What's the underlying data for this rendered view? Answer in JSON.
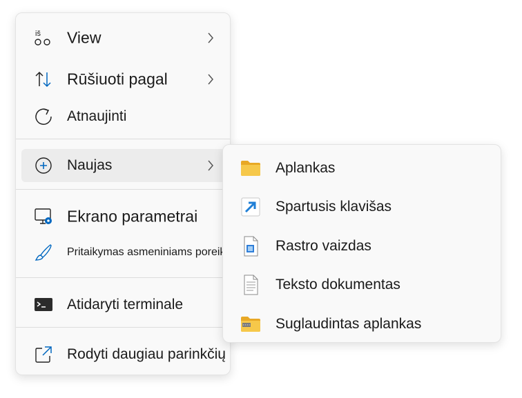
{
  "context_menu": {
    "items": [
      {
        "label": "View",
        "icon": "view-icon",
        "badge": "iš",
        "has_submenu": true
      },
      {
        "label": "Rūšiuoti pagal",
        "icon": "sort-icon",
        "has_submenu": true
      },
      {
        "label": "Atnaujinti",
        "icon": "refresh-icon",
        "has_submenu": false
      },
      {
        "label": "Naujas",
        "icon": "add-circle-icon",
        "has_submenu": true,
        "highlighted": true
      },
      {
        "label": "Ekrano parametrai",
        "icon": "display-settings-icon",
        "has_submenu": false
      },
      {
        "label": "Pritaikymas asmeniniams poreikiams",
        "icon": "paintbrush-icon",
        "has_submenu": false
      },
      {
        "label": "Atidaryti terminale",
        "icon": "terminal-icon",
        "has_submenu": false
      },
      {
        "label": "Rodyti daugiau parinkčių",
        "icon": "share-icon",
        "has_submenu": false
      }
    ]
  },
  "submenu": {
    "items": [
      {
        "label": "Aplankas",
        "icon": "folder-icon"
      },
      {
        "label": "Spartusis klavišas",
        "icon": "shortcut-icon"
      },
      {
        "label": "Rastro vaizdas",
        "icon": "bitmap-image-icon"
      },
      {
        "label": "Teksto dokumentas",
        "icon": "text-document-icon"
      },
      {
        "label": "Suglaudintas aplankas",
        "icon": "zip-folder-icon"
      }
    ]
  },
  "colors": {
    "accent": "#0067c0",
    "folder": "#f4c042",
    "menu_bg": "#f9f9f9",
    "hover_bg": "#ececec"
  }
}
